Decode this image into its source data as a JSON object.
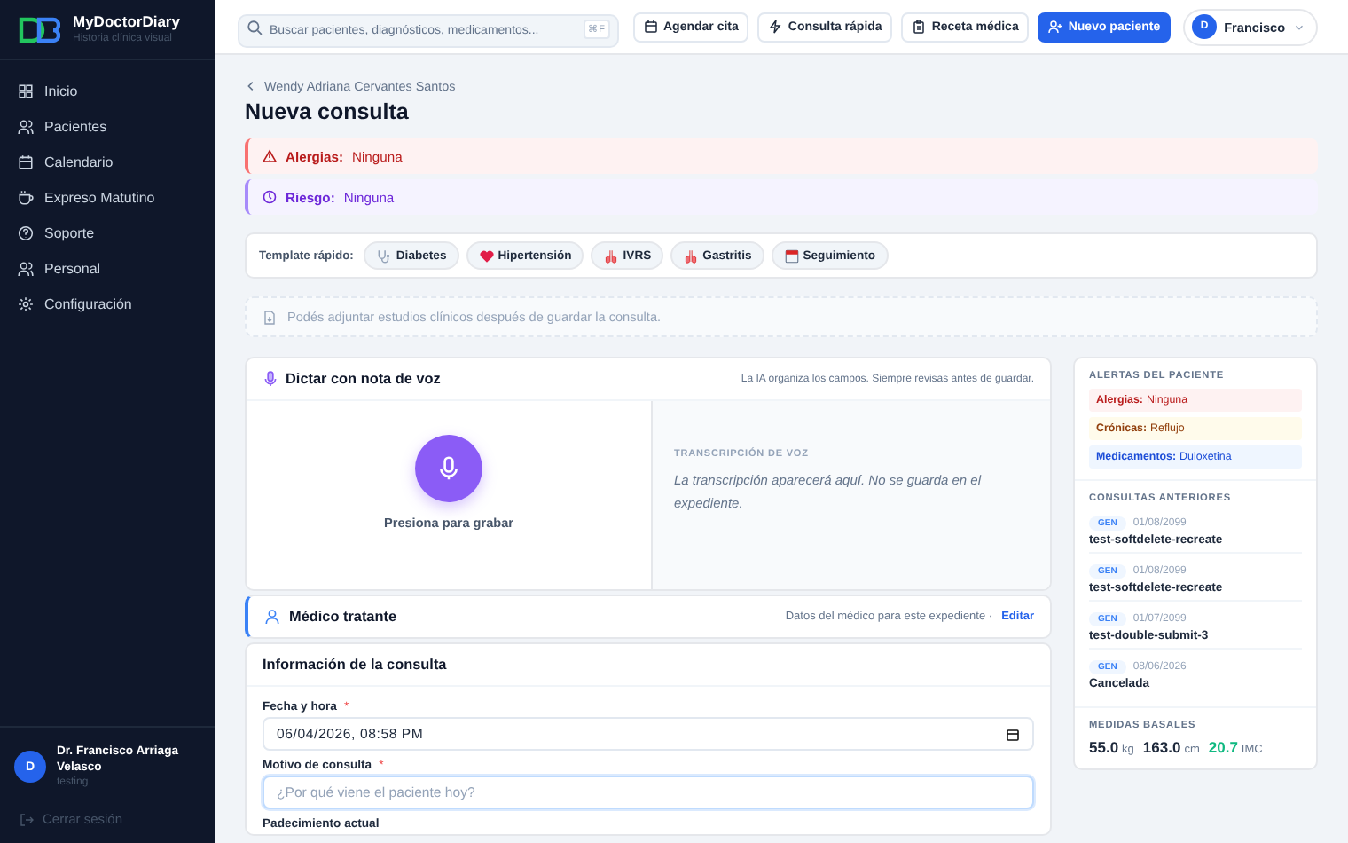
{
  "app": {
    "name": "MyDoctorDiary",
    "tagline": "Historia clínica visual"
  },
  "sidebar": {
    "items": [
      {
        "label": "Inicio",
        "selected": false
      },
      {
        "label": "Pacientes",
        "selected": false
      },
      {
        "label": "Calendario",
        "selected": false
      },
      {
        "label": "Expreso Matutino",
        "selected": false
      },
      {
        "label": "Soporte",
        "selected": false
      },
      {
        "label": "Personal",
        "selected": false
      },
      {
        "label": "Configuración",
        "selected": false
      }
    ],
    "user": {
      "initial": "D",
      "name": "Dr. Francisco Arriaga Velasco",
      "role": "testing"
    },
    "logout": "Cerrar sesión"
  },
  "topbar": {
    "search": {
      "placeholder": "Buscar pacientes, diagnósticos, medicamentos...",
      "shortcut": "⌘F"
    },
    "buttons": [
      {
        "label": "Agendar cita",
        "kind": "outline"
      },
      {
        "label": "Consulta rápida",
        "kind": "outline"
      },
      {
        "label": "Receta médica",
        "kind": "outline"
      },
      {
        "label": "Nuevo paciente",
        "kind": "primary"
      }
    ],
    "user": {
      "initial": "D",
      "name": "Francisco"
    }
  },
  "breadcrumb": "Wendy Adriana Cervantes Santos",
  "title": "Nueva consulta",
  "alerts": [
    {
      "kind": "danger",
      "label": "Alergias:",
      "value": "Ninguna"
    },
    {
      "kind": "risk",
      "label": "Riesgo:",
      "value": "Ninguna"
    }
  ],
  "templates": {
    "label": "Template rápido:",
    "items": [
      {
        "label": "Diabetes"
      },
      {
        "label": "Hipertensión"
      },
      {
        "label": "IVRS"
      },
      {
        "label": "Gastritis"
      },
      {
        "label": "Seguimiento"
      }
    ]
  },
  "attach_note": "Podés adjuntar estudios clínicos después de guardar la consulta.",
  "voice": {
    "title": "Dictar con nota de voz",
    "hint": "La IA organiza los campos. Siempre revisas antes de guardar.",
    "record_label": "Presiona para grabar",
    "transcript_heading": "TRANSCRIPCIÓN DE VOZ",
    "transcript_placeholder": "La transcripción aparecerá aquí. No se guarda en el expediente."
  },
  "doctor": {
    "title": "Médico tratante",
    "note": "Datos del médico para este expediente ·",
    "link": "Editar"
  },
  "consult_form": {
    "title": "Información de la consulta",
    "fields": [
      {
        "kind": "datetime",
        "label": "Fecha y hora",
        "marker": "*",
        "value": "06/04/2026, 08:58 PM"
      },
      {
        "kind": "text",
        "label": "Motivo de consulta",
        "marker": "*",
        "placeholder": "¿Por qué viene el paciente hoy?"
      },
      {
        "kind": "label",
        "label": "Padecimiento actual"
      }
    ]
  },
  "side_panel": {
    "alerts_heading": "ALERTAS DEL PACIENTE",
    "alerts": [
      {
        "kind": "danger",
        "label": "Alergias:",
        "value": "Ninguna"
      },
      {
        "kind": "warning",
        "label": "Crónicas:",
        "value": "Reflujo"
      },
      {
        "kind": "info",
        "label": "Medicamentos:",
        "value": "Duloxetina"
      }
    ],
    "history_heading": "CONSULTAS ANTERIORES",
    "history": [
      {
        "tag": "GEN",
        "date": "01/08/2099",
        "title": "test-softdelete-recreate"
      },
      {
        "tag": "GEN",
        "date": "01/08/2099",
        "title": "test-softdelete-recreate"
      },
      {
        "tag": "GEN",
        "date": "01/07/2099",
        "title": "test-double-submit-3"
      },
      {
        "tag": "GEN",
        "date": "08/06/2026",
        "title": "Cancelada"
      }
    ],
    "measures_heading": "MEDIDAS BASALES",
    "measures": [
      {
        "kind": "plain",
        "value": "55.0",
        "unit": "kg"
      },
      {
        "kind": "plain",
        "value": "163.0",
        "unit": "cm"
      },
      {
        "kind": "highlight",
        "value": "20.7",
        "unit": "IMC"
      }
    ]
  }
}
